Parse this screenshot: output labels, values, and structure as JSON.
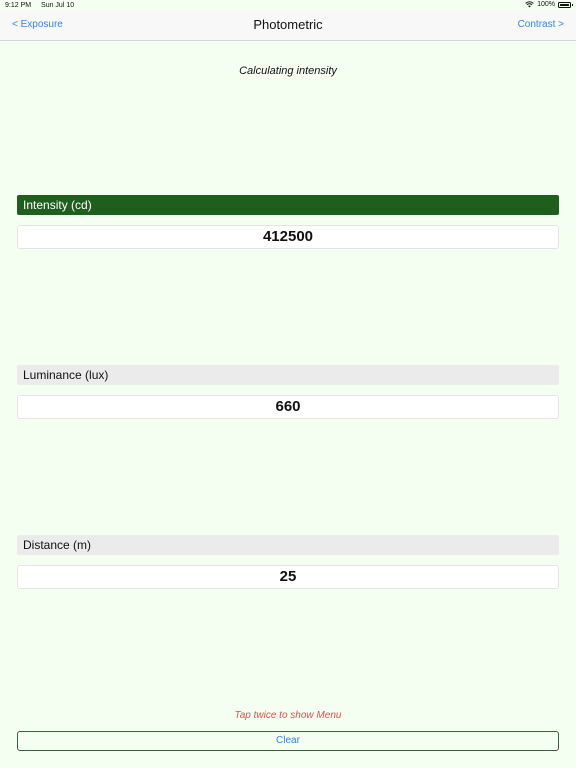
{
  "status_bar": {
    "time": "9:12 PM",
    "date": "Sun Jul 10",
    "battery": "100%",
    "icons": [
      "wifi-icon",
      "battery-icon"
    ]
  },
  "nav": {
    "back_label": "< Exposure",
    "title": "Photometric",
    "forward_label": "Contrast >"
  },
  "subtitle": "Calculating intensity",
  "fields": [
    {
      "label": "Intensity (cd)",
      "value": "412500",
      "active": true
    },
    {
      "label": "Luminance (lux)",
      "value": "660",
      "active": false
    },
    {
      "label": "Distance (m)",
      "value": "25",
      "active": false
    }
  ],
  "hint": "Tap twice to show Menu",
  "clear_label": "Clear",
  "colors": {
    "background": "#f4fff2",
    "accent": "#2f86e8",
    "active_label_bg": "#1f5f1e",
    "inactive_label_bg": "#ebebeb",
    "hint": "#e05050"
  }
}
